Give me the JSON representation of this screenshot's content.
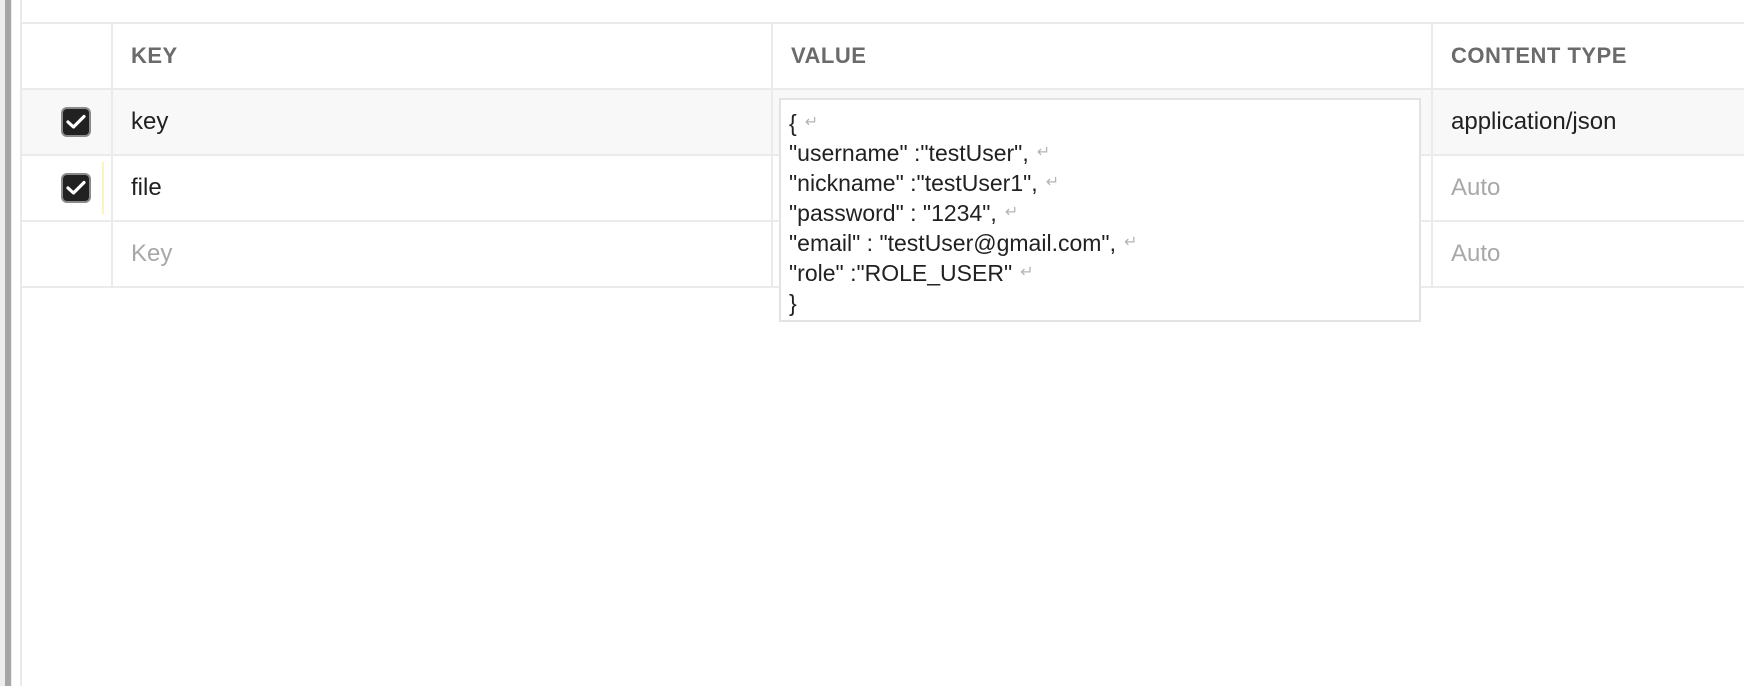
{
  "table": {
    "headers": {
      "key": "KEY",
      "value": "VALUE",
      "content_type": "CONTENT TYPE"
    },
    "rows": [
      {
        "checked": true,
        "key": "key",
        "content_type": "application/json"
      },
      {
        "checked": true,
        "key": "file",
        "content_type_placeholder": "Auto"
      }
    ],
    "new_row": {
      "key_placeholder": "Key",
      "content_type_placeholder": "Auto"
    }
  },
  "value_editor": {
    "lines": [
      "{",
      "\"username\" :\"testUser\",",
      "\"nickname\" :\"testUser1\",",
      "\"password\" : \"1234\",",
      "\"email\" : \"testUser@gmail.com\",",
      "\"role\" :\"ROLE_USER\"",
      "}"
    ],
    "newline_glyph": "↵"
  },
  "icons": {
    "checkbox": "check-icon",
    "newline": "newline-icon"
  },
  "colors": {
    "checkbox_fill": "#212121",
    "header_text": "#6b6b6b",
    "placeholder_text": "#a8a8a8",
    "border": "#ebebeb"
  }
}
